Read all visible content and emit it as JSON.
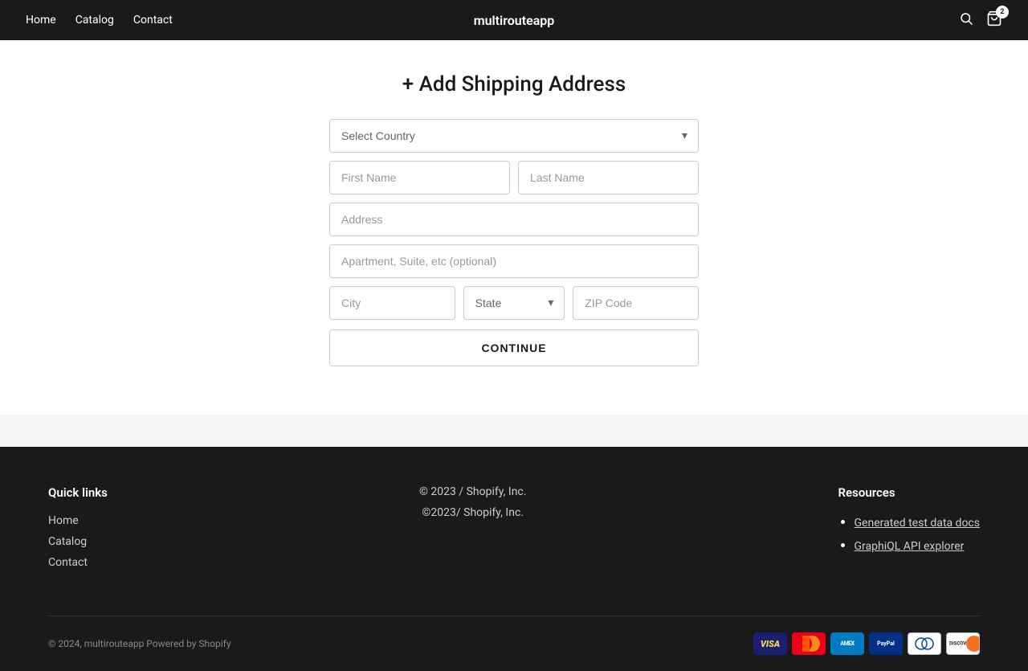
{
  "nav": {
    "links": [
      {
        "label": "Home",
        "href": "#"
      },
      {
        "label": "Catalog",
        "href": "#"
      },
      {
        "label": "Contact",
        "href": "#"
      }
    ],
    "brand": "multirouteapp",
    "cart_count": "2"
  },
  "page": {
    "title": "+ Add Shipping Address"
  },
  "form": {
    "country_placeholder": "Select Country",
    "first_name_placeholder": "First Name",
    "last_name_placeholder": "Last Name",
    "address_placeholder": "Address",
    "apt_placeholder": "Apartment, Suite, etc (optional)",
    "city_placeholder": "City",
    "state_placeholder": "State",
    "zip_placeholder": "ZIP Code",
    "continue_label": "CONTINUE"
  },
  "footer": {
    "quick_links_title": "Quick links",
    "quick_links": [
      {
        "label": "Home",
        "href": "#"
      },
      {
        "label": "Catalog",
        "href": "#"
      },
      {
        "label": "Contact",
        "href": "#"
      }
    ],
    "copyright_line1": "© 2023 / Shopify, Inc.",
    "copyright_line2": "©2023/ Shopify, Inc.",
    "resources_title": "Resources",
    "resources": [
      {
        "label": "Generated test data docs",
        "href": "#"
      },
      {
        "label": "GraphiQL API explorer",
        "href": "#"
      }
    ],
    "bottom_copyright": "© 2024, multirouteapp Powered by Shopify"
  },
  "payment_methods": [
    {
      "name": "visa",
      "label": "VISA"
    },
    {
      "name": "mastercard",
      "label": "MC"
    },
    {
      "name": "amex",
      "label": "AMEX"
    },
    {
      "name": "paypal",
      "label": "PayPal"
    },
    {
      "name": "diners",
      "label": "DC"
    },
    {
      "name": "discover",
      "label": "DISC"
    }
  ]
}
